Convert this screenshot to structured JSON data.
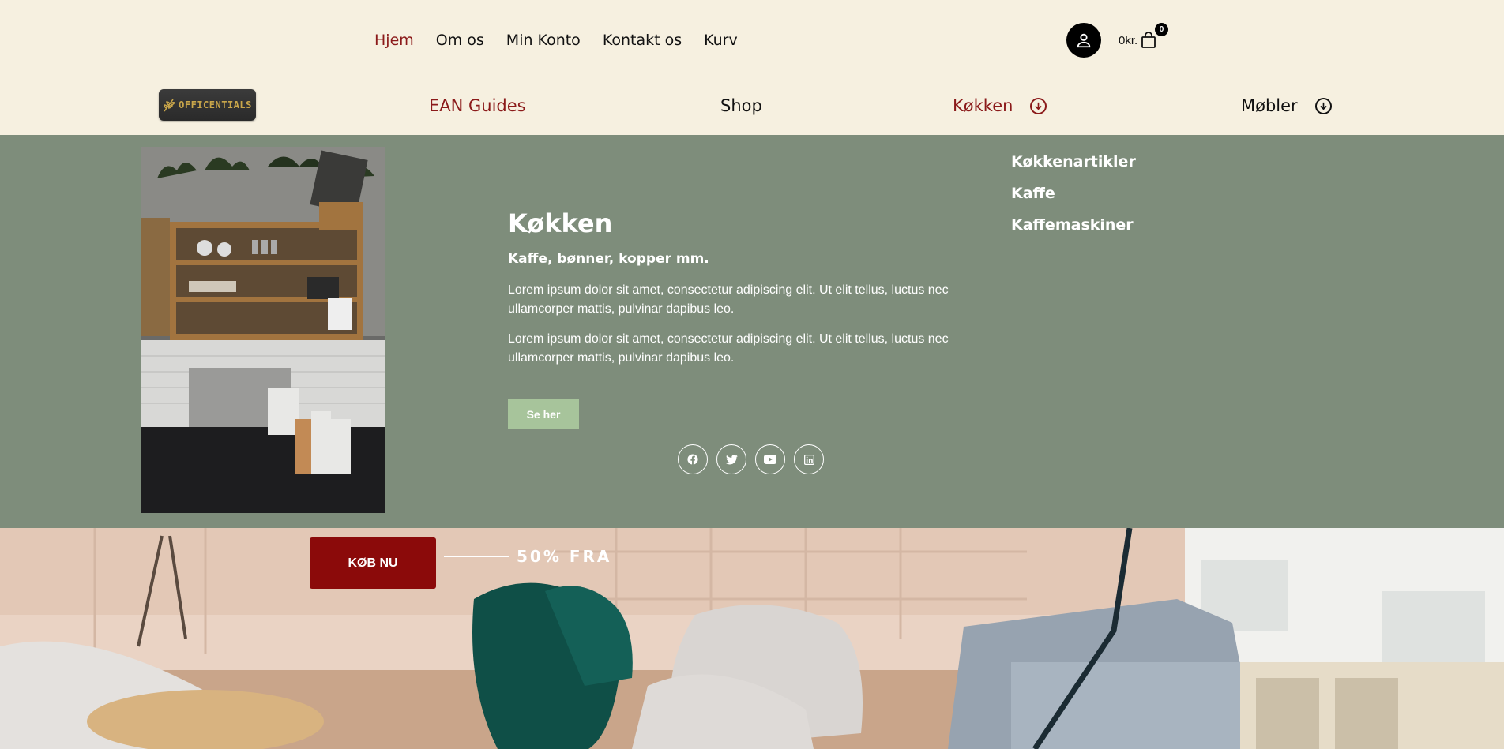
{
  "top_nav": {
    "items": [
      {
        "label": "Hjem",
        "active": true
      },
      {
        "label": "Om os",
        "active": false
      },
      {
        "label": "Min Konto",
        "active": false
      },
      {
        "label": "Kontakt os",
        "active": false
      },
      {
        "label": "Kurv",
        "active": false
      }
    ],
    "cart": {
      "total": "0kr.",
      "count": "0"
    }
  },
  "logo": {
    "text": "OFFICENTIALS"
  },
  "main_nav": {
    "ean": "EAN Guides",
    "shop": "Shop",
    "kokken": "Køkken",
    "mobler": "Møbler"
  },
  "mega_menu": {
    "title": "Køkken",
    "subtitle": "Kaffe, bønner, kopper mm.",
    "paragraphs": [
      "Lorem ipsum dolor sit amet, consectetur adipiscing elit. Ut elit tellus, luctus nec ullamcorper mattis, pulvinar dapibus leo.",
      "Lorem ipsum dolor sit amet, consectetur adipiscing elit. Ut elit tellus, luctus nec ullamcorper mattis, pulvinar dapibus leo."
    ],
    "button": "Se her",
    "links": [
      "Køkkenartikler",
      "Kaffe",
      "Kaffemaskiner"
    ],
    "socials": [
      "facebook-icon",
      "twitter-icon",
      "youtube-icon",
      "linkedin-icon"
    ]
  },
  "hero": {
    "button": "KØB NU",
    "promo": "50% FRA"
  },
  "colors": {
    "accent": "#8b1a1a",
    "page_bg": "#f6f0e0",
    "mega_bg": "#7e8d7b",
    "button_green": "#a7c49b",
    "cta_red": "#8b0a0a"
  }
}
